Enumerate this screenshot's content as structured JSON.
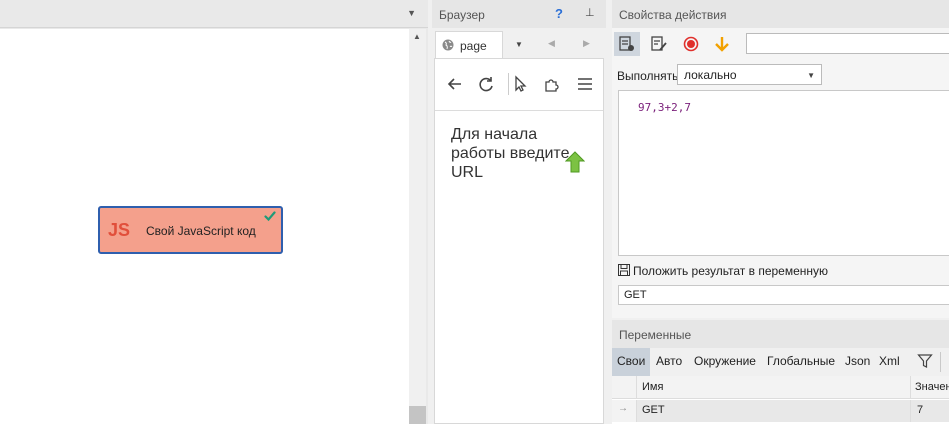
{
  "canvas": {
    "block": {
      "badge": "JS",
      "label": "Свой JavaScript код",
      "check_icon": "checkmark-icon"
    }
  },
  "browser": {
    "title": "Браузер",
    "help": "?",
    "tab": {
      "label": "page",
      "icon": "globe-icon"
    },
    "tools": [
      "back-icon",
      "reload-icon",
      "pointer-icon",
      "puzzle-icon",
      "menu-icon"
    ],
    "message": "Для начала работы введите URL",
    "arrow_icon": "upload-arrow-icon"
  },
  "properties": {
    "title": "Свойства действия",
    "execute_label": "Выполнять",
    "execute_value": "локально",
    "code": "97,3+2,7",
    "save_label": "Положить результат в переменную",
    "variable_value": "GET",
    "colors": {
      "record": "#e0302c",
      "download": "#f2a100"
    }
  },
  "variables": {
    "title": "Переменные",
    "tabs": [
      "Свои",
      "Авто",
      "Окружение",
      "Глобальные",
      "Json",
      "Xml"
    ],
    "columns": {
      "name": "Имя",
      "value": "Значен"
    },
    "rows": [
      {
        "arrow": "→",
        "name": "GET",
        "value": "7"
      }
    ]
  }
}
